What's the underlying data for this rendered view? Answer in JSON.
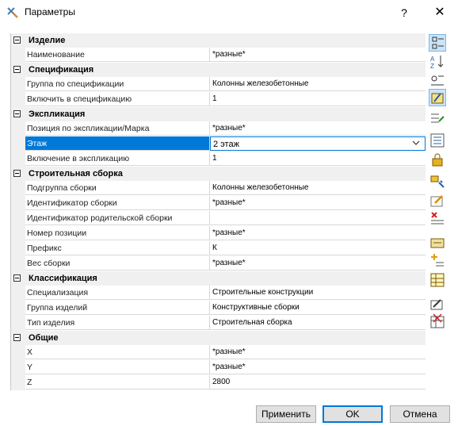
{
  "window": {
    "title": "Параметры",
    "help_label": "?",
    "close_label": "✕"
  },
  "categories": [
    {
      "label": "Изделие",
      "rows": [
        {
          "name": "Наименование",
          "value": "*разные*"
        }
      ]
    },
    {
      "label": "Спецификация",
      "rows": [
        {
          "name": "Группа по спецификации",
          "value": "Колонны железобетонные"
        },
        {
          "name": "Включить в спецификацию",
          "value": "1"
        }
      ]
    },
    {
      "label": "Экспликация",
      "rows": [
        {
          "name": "Позиция по экспликации/Марка",
          "value": "*разные*"
        },
        {
          "name": "Этаж",
          "value": "2 этаж"
        },
        {
          "name": "Включение в экспликацию",
          "value": "1"
        }
      ]
    },
    {
      "label": "Строительная сборка",
      "rows": [
        {
          "name": "Подгруппа сборки",
          "value": "Колонны железобетонные"
        },
        {
          "name": "Идентификатор сборки",
          "value": "*разные*"
        },
        {
          "name": "Идентификатор родительской сборки",
          "value": ""
        },
        {
          "name": "Номер позиции",
          "value": "*разные*"
        },
        {
          "name": "Префикс",
          "value": "К"
        },
        {
          "name": "Вес сборки",
          "value": "*разные*"
        }
      ]
    },
    {
      "label": "Классификация",
      "rows": [
        {
          "name": "Специализация",
          "value": "Строительные конструкции"
        },
        {
          "name": "Группа изделий",
          "value": "Конструктивные сборки"
        },
        {
          "name": "Тип изделия",
          "value": "Строительная сборка"
        }
      ]
    },
    {
      "label": "Общие",
      "rows": [
        {
          "name": "X",
          "value": "*разные*"
        },
        {
          "name": "Y",
          "value": "*разные*"
        },
        {
          "name": "Z",
          "value": "2800"
        }
      ]
    }
  ],
  "toolbar": {
    "icons": [
      "categorized-icon",
      "sort-alphabetic-icon",
      "filter-icon",
      "edit-properties-icon",
      "select-objects-icon",
      "list-icon",
      "lock-icon",
      "pick-icon",
      "edit-icon",
      "delete-icon",
      "materials-icon",
      "new-icon",
      "table-icon",
      "signature-icon",
      "delete-table-icon"
    ]
  },
  "buttons": {
    "apply": "Применить",
    "ok": "OK",
    "cancel": "Отмена"
  },
  "colors": {
    "selection": "#0078d7",
    "category_bg": "#f0f0f0"
  }
}
